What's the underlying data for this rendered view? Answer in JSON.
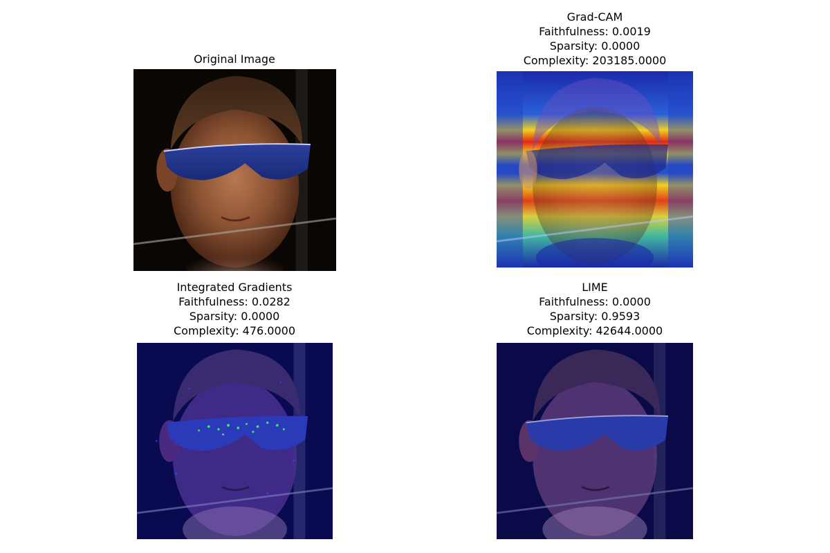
{
  "panels": [
    {
      "title": "Original Image",
      "metrics": []
    },
    {
      "title": "Grad-CAM",
      "metrics": [
        "Faithfulness: 0.0019",
        "Sparsity: 0.0000",
        "Complexity: 203185.0000"
      ]
    },
    {
      "title": "Integrated Gradients",
      "metrics": [
        "Faithfulness: 0.0282",
        "Sparsity: 0.0000",
        "Complexity: 476.0000"
      ]
    },
    {
      "title": "LIME",
      "metrics": [
        "Faithfulness: 0.0000",
        "Sparsity: 0.9593",
        "Complexity: 42644.0000"
      ]
    }
  ]
}
